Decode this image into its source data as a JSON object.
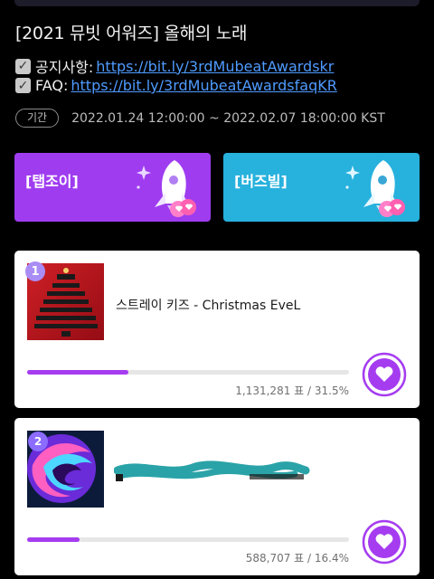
{
  "title": "[2021 뮤빗 어워즈] 올해의 노래",
  "notice": {
    "label": "공지사항: ",
    "url": "https://bit.ly/3rdMubeatAwardskr"
  },
  "faq": {
    "label": "FAQ: ",
    "url": "https://bit.ly/3rdMubeatAwardsfaqKR"
  },
  "period": {
    "badge": "기간",
    "range": "2022.01.24 12:00:00 ~ 2022.02.07 18:00:00 KST"
  },
  "vote_buttons": [
    {
      "label": "[탭조이]",
      "color": "#9f3cf0"
    },
    {
      "label": "[버즈빌]",
      "color": "#27b1dd"
    }
  ],
  "ranking": [
    {
      "rank": "1",
      "song": "스트레이 키즈 - Christmas EveL",
      "votes_text": "1,131,281 표 / 31.5%",
      "progress_fraction": 0.315
    },
    {
      "rank": "2",
      "song": "",
      "votes_text": "588,707 표 / 16.4%",
      "progress_fraction": 0.164
    }
  ],
  "colors": {
    "accent": "#a53cf0",
    "link": "#4f9bff",
    "background": "#000000"
  }
}
